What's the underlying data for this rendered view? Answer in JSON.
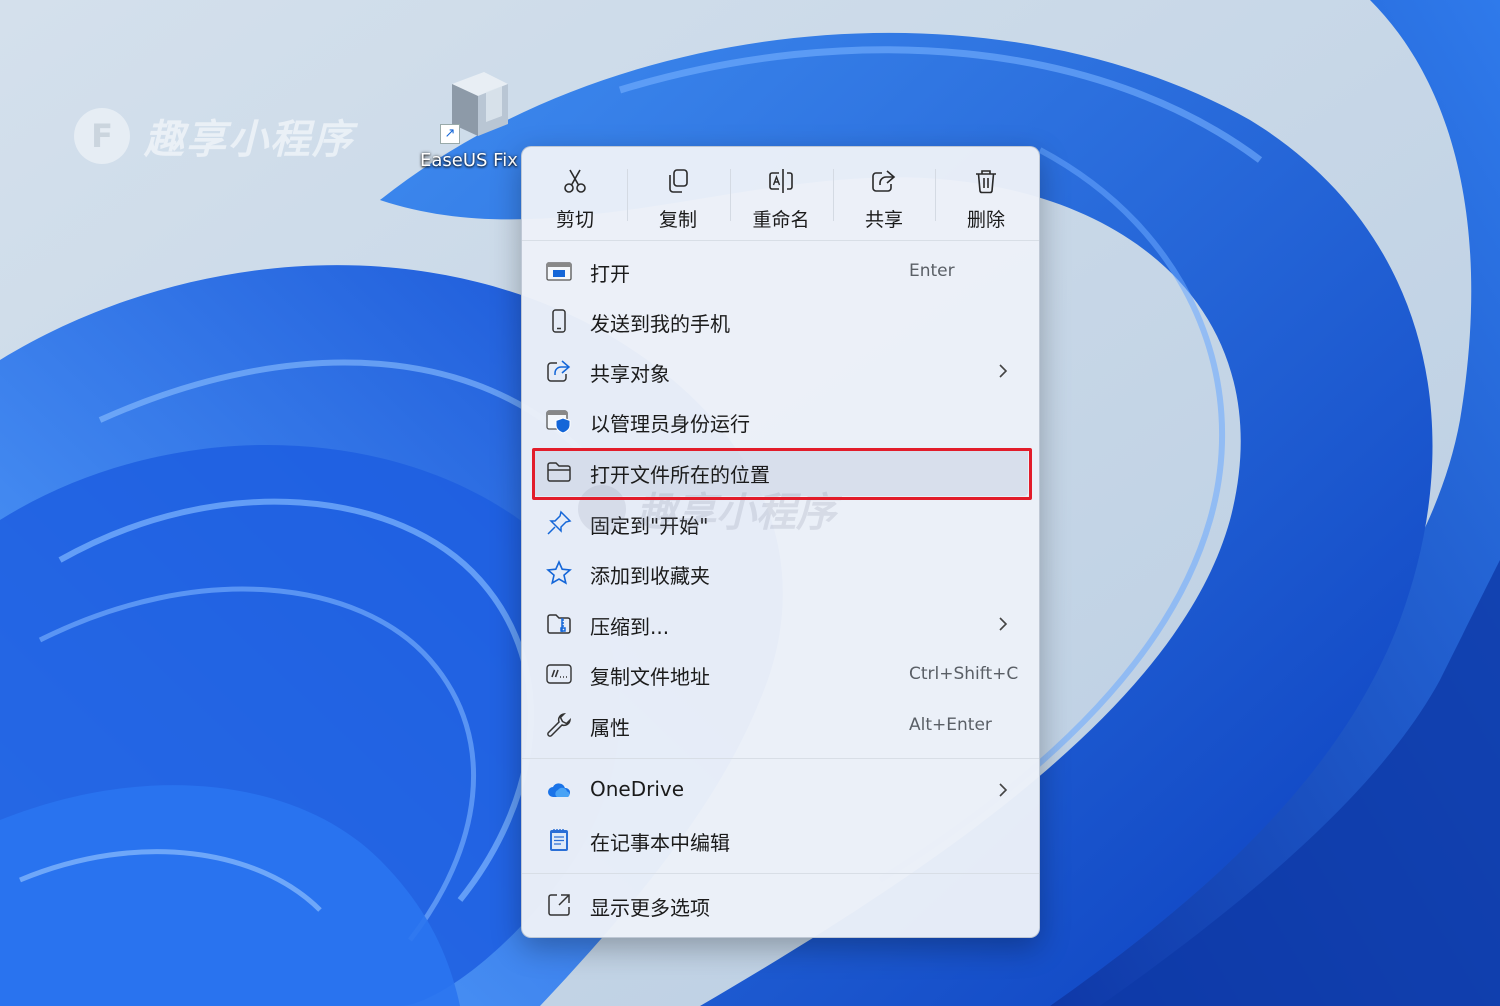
{
  "watermark": {
    "logo_letter": "F",
    "text": "趣享小程序"
  },
  "desktop_icon": {
    "label": "EaseUS Fix",
    "shortcut_glyph": "↗"
  },
  "toolbar": {
    "cut_label": "剪切",
    "copy_label": "复制",
    "rename_label": "重命名",
    "share_label": "共享",
    "delete_label": "删除"
  },
  "menu": {
    "items": [
      {
        "label": "打开",
        "shortcut": "Enter",
        "icon": "open-window-icon"
      },
      {
        "label": "发送到我的手机",
        "icon": "phone-icon"
      },
      {
        "label": "共享对象",
        "icon": "share-icon",
        "submenu": true
      },
      {
        "label": "以管理员身份运行",
        "icon": "admin-shield-icon"
      },
      {
        "label": "打开文件所在的位置",
        "icon": "folder-icon"
      },
      {
        "label": "固定到\"开始\"",
        "icon": "pin-icon"
      },
      {
        "label": "添加到收藏夹",
        "icon": "star-icon"
      },
      {
        "label": "压缩到...",
        "icon": "zip-icon",
        "submenu": true
      },
      {
        "label": "复制文件地址",
        "shortcut": "Ctrl+Shift+C",
        "icon": "path-icon"
      },
      {
        "label": "属性",
        "shortcut": "Alt+Enter",
        "icon": "wrench-icon"
      }
    ],
    "apps": [
      {
        "label": "OneDrive",
        "icon": "onedrive-cloud-icon",
        "submenu": true
      },
      {
        "label": "在记事本中编辑",
        "icon": "notepad-icon"
      }
    ],
    "more_label": "显示更多选项"
  },
  "colors": {
    "highlight_border": "#e21c2a",
    "accent": "#1466d8",
    "menu_bg": "#ecf1f8"
  }
}
